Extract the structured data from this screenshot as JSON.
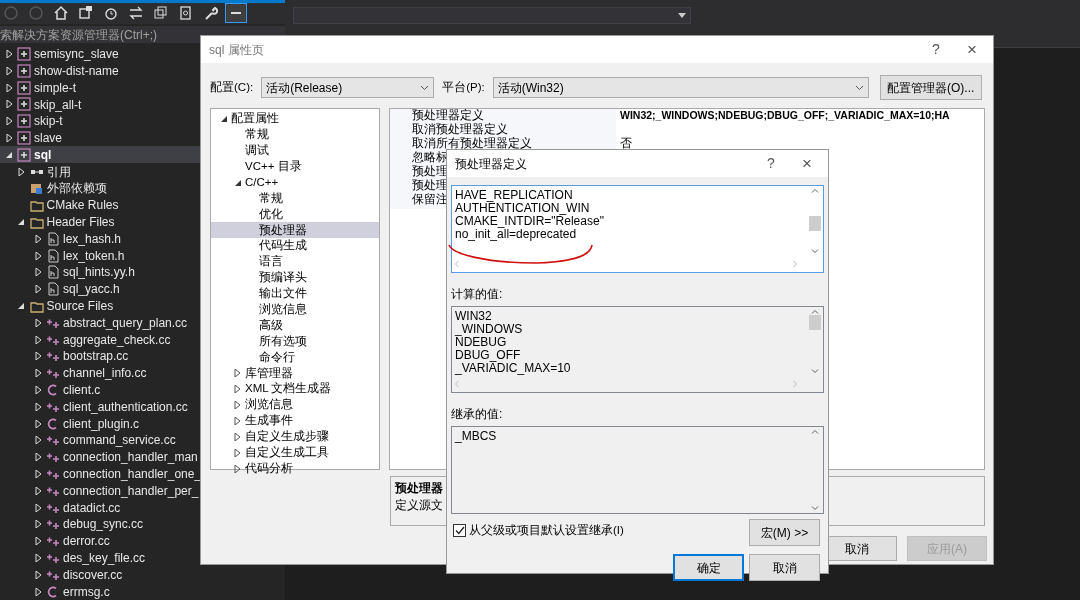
{
  "solution_explorer": {
    "search_placeholder": "索解决方案资源管理器(Ctrl+;)",
    "items": [
      {
        "label": "semisync_slave",
        "kind": "project",
        "expanded": false,
        "selected": false
      },
      {
        "label": "show-dist-name",
        "kind": "project",
        "expanded": false,
        "selected": false
      },
      {
        "label": "simple-t",
        "kind": "project",
        "expanded": false,
        "selected": false
      },
      {
        "label": "skip_all-t",
        "kind": "project",
        "expanded": false,
        "selected": false
      },
      {
        "label": "skip-t",
        "kind": "project",
        "expanded": false,
        "selected": false
      },
      {
        "label": "slave",
        "kind": "project",
        "expanded": false,
        "selected": false
      },
      {
        "label": "sql",
        "kind": "project",
        "expanded": true,
        "selected": true,
        "children": [
          {
            "label": "引用",
            "kind": "references",
            "expanded": false,
            "selected": false
          },
          {
            "label": "外部依赖项",
            "kind": "dependencies",
            "selected": false
          },
          {
            "label": "CMake Rules",
            "kind": "filter",
            "selected": false
          },
          {
            "label": "Header Files",
            "kind": "filter",
            "expanded": true,
            "selected": false,
            "children": [
              {
                "label": "lex_hash.h",
                "kind": "header",
                "expanded": false,
                "selected": false
              },
              {
                "label": "lex_token.h",
                "kind": "header",
                "expanded": false,
                "selected": false
              },
              {
                "label": "sql_hints.yy.h",
                "kind": "header",
                "expanded": false,
                "selected": false
              },
              {
                "label": "sql_yacc.h",
                "kind": "header",
                "expanded": false,
                "selected": false
              }
            ]
          },
          {
            "label": "Source Files",
            "kind": "filter",
            "expanded": true,
            "selected": false,
            "children": [
              {
                "label": "abstract_query_plan.cc",
                "kind": "cpp",
                "expanded": false,
                "selected": false
              },
              {
                "label": "aggregate_check.cc",
                "kind": "cpp",
                "expanded": false,
                "selected": false
              },
              {
                "label": "bootstrap.cc",
                "kind": "cpp",
                "expanded": false,
                "selected": false
              },
              {
                "label": "channel_info.cc",
                "kind": "cpp",
                "expanded": false,
                "selected": false
              },
              {
                "label": "client.c",
                "kind": "c",
                "expanded": false,
                "selected": false
              },
              {
                "label": "client_authentication.cc",
                "kind": "cpp",
                "expanded": false,
                "selected": false
              },
              {
                "label": "client_plugin.c",
                "kind": "c",
                "expanded": false,
                "selected": false
              },
              {
                "label": "command_service.cc",
                "kind": "cpp",
                "expanded": false,
                "selected": false
              },
              {
                "label": "connection_handler_man",
                "kind": "cpp",
                "expanded": false,
                "selected": false
              },
              {
                "label": "connection_handler_one_",
                "kind": "cpp",
                "expanded": false,
                "selected": false
              },
              {
                "label": "connection_handler_per_",
                "kind": "cpp",
                "expanded": false,
                "selected": false
              },
              {
                "label": "datadict.cc",
                "kind": "cpp",
                "expanded": false,
                "selected": false
              },
              {
                "label": "debug_sync.cc",
                "kind": "cpp",
                "expanded": false,
                "selected": false
              },
              {
                "label": "derror.cc",
                "kind": "cpp",
                "expanded": false,
                "selected": false
              },
              {
                "label": "des_key_file.cc",
                "kind": "cpp",
                "expanded": false,
                "selected": false
              },
              {
                "label": "discover.cc",
                "kind": "cpp",
                "expanded": false,
                "selected": false
              },
              {
                "label": "errmsg.c",
                "kind": "c",
                "expanded": false,
                "selected": false
              }
            ]
          }
        ]
      }
    ]
  },
  "property_pages": {
    "title": "sql 属性页",
    "help": "?",
    "close": "×",
    "configuration": {
      "label": "配置(C):",
      "value": "活动(Release)"
    },
    "platform": {
      "label": "平台(P):",
      "value": "活动(Win32)"
    },
    "config_manager_button": "配置管理器(O)...",
    "tree": [
      {
        "label": "配置属性",
        "expanded": true,
        "selected": false,
        "children": [
          {
            "label": "常规",
            "selected": false
          },
          {
            "label": "调试",
            "selected": false
          },
          {
            "label": "VC++ 目录",
            "selected": false
          },
          {
            "label": "C/C++",
            "expanded": true,
            "selected": false,
            "children": [
              {
                "label": "常规",
                "selected": false
              },
              {
                "label": "优化",
                "selected": false
              },
              {
                "label": "预处理器",
                "selected": true
              },
              {
                "label": "代码生成",
                "selected": false
              },
              {
                "label": "语言",
                "selected": false
              },
              {
                "label": "预编译头",
                "selected": false
              },
              {
                "label": "输出文件",
                "selected": false
              },
              {
                "label": "浏览信息",
                "selected": false
              },
              {
                "label": "高级",
                "selected": false
              },
              {
                "label": "所有选项",
                "selected": false
              },
              {
                "label": "命令行",
                "selected": false
              }
            ]
          },
          {
            "label": "库管理器",
            "expanded": false,
            "selected": false
          },
          {
            "label": "XML 文档生成器",
            "expanded": false,
            "selected": false
          },
          {
            "label": "浏览信息",
            "expanded": false,
            "selected": false
          },
          {
            "label": "生成事件",
            "expanded": false,
            "selected": false
          },
          {
            "label": "自定义生成步骤",
            "expanded": false,
            "selected": false
          },
          {
            "label": "自定义生成工具",
            "expanded": false,
            "selected": false
          },
          {
            "label": "代码分析",
            "expanded": false,
            "selected": false
          }
        ]
      }
    ],
    "grid": [
      {
        "name": "预处理器定义",
        "value": "WIN32;_WINDOWS;NDEBUG;DBUG_OFF;_VARIADIC_MAX=10;HA",
        "modified": true
      },
      {
        "name": "取消预处理器定义"
      },
      {
        "name": "取消所有预处理器定义",
        "value": "否",
        "modified": false
      },
      {
        "name": "忽略标"
      },
      {
        "name": "预处理"
      },
      {
        "name": "预处理"
      },
      {
        "name": "保留注"
      }
    ],
    "description": {
      "title": "预处理器",
      "text": "定义源文"
    },
    "buttons": [
      {
        "label": "取消",
        "disabled": false
      },
      {
        "label": "应用(A)",
        "disabled": true
      }
    ]
  },
  "preprocessor_dialog": {
    "title": "预处理器定义",
    "help": "?",
    "close": "×",
    "definitions": [
      "HAVE_REPLICATION",
      "AUTHENTICATION_WIN",
      "CMAKE_INTDIR=\"Release\"",
      "no_init_all=deprecated"
    ],
    "computed_label": "计算的值:",
    "computed": [
      "WIN32",
      "_WINDOWS",
      "NDEBUG",
      "DBUG_OFF",
      "_VARIADIC_MAX=10"
    ],
    "inherited_label": "继承的值:",
    "inherited": [
      "_MBCS"
    ],
    "inherit_checkbox": {
      "label": "从父级或项目默认设置继承(I)",
      "checked": true
    },
    "macros_button": "宏(M) >>",
    "buttons": [
      {
        "label": "确定",
        "default": true
      },
      {
        "label": "取消",
        "default": false
      }
    ]
  }
}
